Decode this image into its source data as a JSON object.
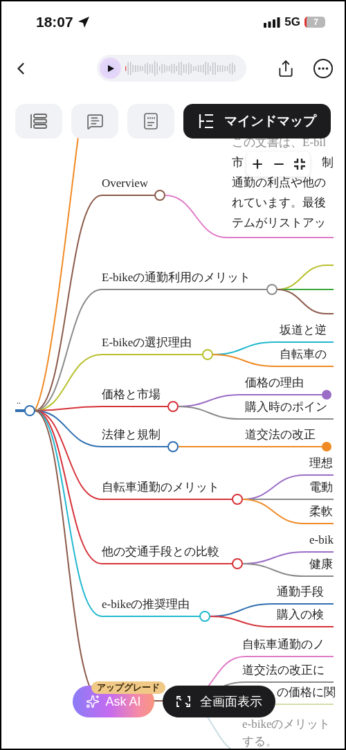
{
  "status_bar": {
    "time": "18:07",
    "network": "5G",
    "battery": "7"
  },
  "tabs": [
    {
      "kind": "list",
      "selected": false
    },
    {
      "kind": "chat",
      "selected": false
    },
    {
      "kind": "quote",
      "selected": false
    },
    {
      "kind": "mindmap",
      "label": "マインドマップ",
      "selected": true
    }
  ],
  "mindmap": {
    "root": "..",
    "branches": [
      {
        "color": "#f08a24"
      },
      {
        "label": "Overview",
        "color": "#8b5a4a",
        "children": [
          {
            "kind": "paragraph",
            "color": "#e07bc8",
            "lines": [
              "この文書は、E-bil",
              [
                "市",
                "制"
              ],
              "通勤の利点や他の",
              "れています。最後",
              "テムがリストアッ"
            ]
          }
        ]
      },
      {
        "label": "E-bikeの通勤利用のメリット",
        "color": "#8a8a8a",
        "children": [
          {
            "kind": "line",
            "color": "#b8c02c"
          },
          {
            "kind": "line",
            "color": "#3aa83a"
          },
          {
            "kind": "line",
            "color": "#8b5a4a"
          }
        ]
      },
      {
        "label": "E-bikeの選択理由",
        "color": "#b8c02c",
        "children": [
          {
            "kind": "topic",
            "label": "坂道と逆",
            "color": "#22b8cf",
            "collapsed": false
          },
          {
            "kind": "topic",
            "label": "自転車の",
            "color": "#f08a24",
            "collapsed": false
          }
        ]
      },
      {
        "label": "価格と市場",
        "color": "#d6333a",
        "children": [
          {
            "kind": "topic",
            "label": "価格の理由",
            "color": "#9b6cc6",
            "collapsed": true
          },
          {
            "kind": "topic",
            "label": "購入時のポイン",
            "color": "#8a8a8a",
            "collapsed": false
          }
        ]
      },
      {
        "label": "法律と規制",
        "color": "#2f6fb0",
        "children": [
          {
            "kind": "topic",
            "label": "道交法の改正",
            "color": "#f08a24",
            "collapsed": true
          }
        ]
      },
      {
        "label": "自転車通勤のメリット",
        "color": "#d6333a",
        "children": [
          {
            "kind": "topic",
            "label": "理想",
            "color": "#9b6cc6",
            "collapsed": false
          },
          {
            "kind": "topic",
            "label": "電動",
            "color": "#8a8a8a",
            "collapsed": false
          },
          {
            "kind": "topic",
            "label": "柔軟",
            "color": "#f08a24",
            "collapsed": false
          }
        ]
      },
      {
        "label": "他の交通手段との比較",
        "color": "#d6333a",
        "children": [
          {
            "kind": "topic",
            "label": "e-bik",
            "color": "#9b6cc6",
            "collapsed": false
          },
          {
            "kind": "topic",
            "label": "健康",
            "color": "#8a8a8a",
            "collapsed": false
          }
        ]
      },
      {
        "label": "e-bikeの推奨理由",
        "color": "#22b8cf",
        "children": [
          {
            "kind": "topic",
            "label": "通勤手段",
            "color": "#2f6fb0",
            "collapsed": false
          },
          {
            "kind": "topic",
            "label": "購入の検",
            "color": "#d6333a",
            "collapsed": false
          }
        ]
      },
      {
        "color": "#8b5a4a",
        "children": [
          {
            "kind": "topic",
            "label": "自転車通勤のノ",
            "color": "#e07bc8",
            "collapsed": false
          },
          {
            "kind": "topic",
            "label": "道交法の改正に",
            "color": "#8a8a8a",
            "collapsed": false
          },
          {
            "kind": "topic",
            "label": "の価格に関",
            "color": "#d9dca8",
            "collapsed": false
          },
          {
            "kind": "paragraph",
            "color": "#c9dde3",
            "lines": [
              "e-bikeのメリット",
              "する。"
            ]
          }
        ]
      }
    ]
  },
  "ask_ai": {
    "label": "Ask AI",
    "badge": "アップグレード"
  },
  "fullscreen_button": {
    "label": "全画面表示"
  }
}
